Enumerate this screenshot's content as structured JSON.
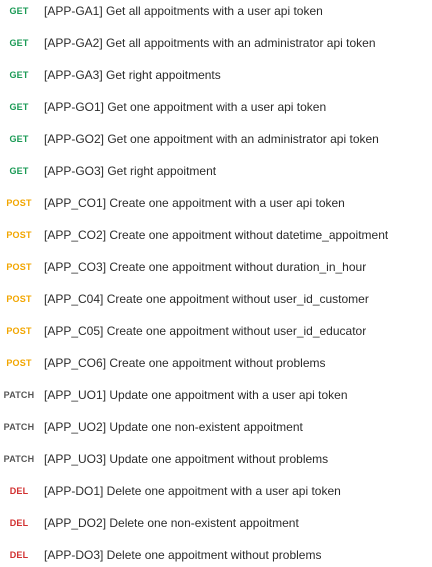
{
  "method_colors": {
    "GET": "#1a9a55",
    "POST": "#f2a600",
    "PATCH": "#555555",
    "DEL": "#d12f2f"
  },
  "requests": [
    {
      "method": "GET",
      "name": "[APP-GA1] Get all appoitments with a user api token"
    },
    {
      "method": "GET",
      "name": "[APP-GA2] Get all appoitments with an administrator api token"
    },
    {
      "method": "GET",
      "name": "[APP-GA3] Get right appoitments"
    },
    {
      "method": "GET",
      "name": "[APP-GO1] Get one appoitment with a user api token"
    },
    {
      "method": "GET",
      "name": "[APP-GO2] Get one appoitment with an administrator api token"
    },
    {
      "method": "GET",
      "name": "[APP-GO3] Get right appoitment"
    },
    {
      "method": "POST",
      "name": "[APP_CO1] Create one appoitment with a user api token"
    },
    {
      "method": "POST",
      "name": "[APP_CO2] Create one appoitment without datetime_appoitment"
    },
    {
      "method": "POST",
      "name": "[APP_CO3] Create one appoitment without duration_in_hour"
    },
    {
      "method": "POST",
      "name": "[APP_C04] Create one appoitment without user_id_customer"
    },
    {
      "method": "POST",
      "name": "[APP_C05] Create one appoitment without user_id_educator"
    },
    {
      "method": "POST",
      "name": "[APP_CO6] Create one appoitment without problems"
    },
    {
      "method": "PATCH",
      "name": "[APP_UO1] Update one appoitment with a user api token"
    },
    {
      "method": "PATCH",
      "name": "[APP_UO2] Update one non-existent appoitment"
    },
    {
      "method": "PATCH",
      "name": "[APP_UO3] Update one appoitment without problems"
    },
    {
      "method": "DEL",
      "name": "[APP-DO1] Delete one appoitment with a user api token"
    },
    {
      "method": "DEL",
      "name": "[APP_DO2] Delete one non-existent appoitment"
    },
    {
      "method": "DEL",
      "name": "[APP-DO3] Delete one appoitment without problems"
    }
  ]
}
